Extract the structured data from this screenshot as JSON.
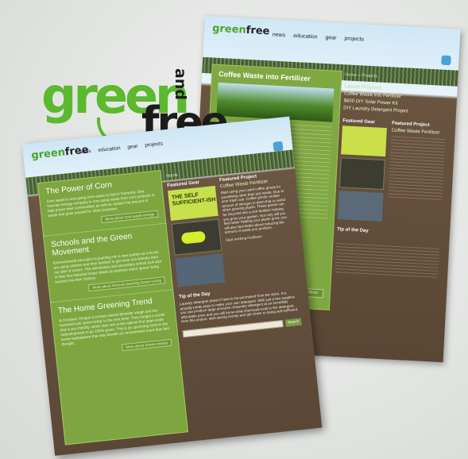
{
  "logo": {
    "green": "green",
    "and": "and",
    "free": "free"
  },
  "back_page": {
    "logo_text": "green",
    "logo_text2": "free",
    "nav": [
      "news",
      "education",
      "gear",
      "projects"
    ],
    "main_title": "Coffee Waste into Fertilizer",
    "main_button": "Read Coffee Fertilizer",
    "breadcrumb": "Home » Projects",
    "latest_heading": "Latest Projects",
    "latest_links": [
      "Coffee Waste into Fertilizer",
      "$600 DIY Solar Power Kit",
      "DIY Laundry Detergent Project"
    ],
    "featured_gear": "Featured Gear",
    "featured_project": "Featured Project",
    "featured_project_title": "Coffee Waste Fertilizer",
    "tip_heading": "Tip of the Day"
  },
  "front_page": {
    "logo_text": "green",
    "logo_text2": "free",
    "nav": [
      "news",
      "education",
      "gear",
      "projects"
    ],
    "sections": [
      {
        "title": "The Power of Corn",
        "body": "Corn waste is now going from waste to fuel in Germany. One German energy company is now using waste from corn products to help power their communities as well as replace the amount of waste that goes unused for other purposes.",
        "more": "More about corn waste energy"
      },
      {
        "title": "Schools and the Green Movement",
        "body": "Environmental education is pushing into a new system as schools are using children and their families to get more eco-friendly lives out side of school. This elementary and secondary school took part in their first National Green Week as teachers share 'green' living lessons into their classes.",
        "more": "More about Schools teaching Green Living"
      },
      {
        "title": "The Home Greening Trend",
        "body": "In Portland, Oregon a woman named Michelle Vaugh and her husband took 'green living' to the next level. They bought a condo that is eco-friendly, which was one of the nations first large-scale redevelopment to go 100% green. This is an upcoming trend in the home marketplace that may benefit our environment more than first thought.",
        "more": "More about Green Homes"
      }
    ],
    "breadcrumb": "Home",
    "featured_gear": "Featured Gear",
    "gear_box_text": "THE SELF SUFFICIENT-ISH",
    "featured_project": "Featured Project",
    "featured_project_title": "Coffee Waste Fertilizer",
    "featured_project_body": "Start using your used coffee grinds for something other than just waste. Due to your trash can. Coffee grinds contain amount of nitrogen in them that is useful when growing plants. These grinds can be recycled into a rich fertilizer helping you grow your garden. Not only will you feel better helping your plants grow, you will also feel better about reducing the amount of waste you produce.",
    "featured_project_more": "Start working Fertilizer!",
    "tip_heading": "Tip of the Day",
    "tip_body": "Laundry detergent doesn't have to be purchased from the store. It is actually pretty easy to make your own detergent. With just a few supplies you can produce large amounts of laundry detergent at an incredibly affordable price and you will know what chemicals exist in the detergent. Now this project, start saving money and get closer to being self-sufficient.",
    "search_button": "Search"
  }
}
